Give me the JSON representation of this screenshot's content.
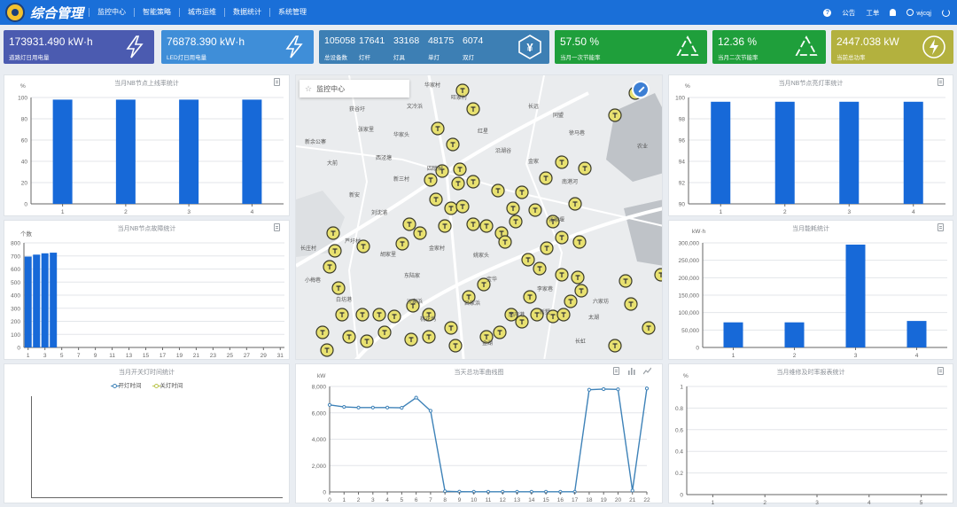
{
  "nav": {
    "title": "综合管理",
    "items": [
      "监控中心",
      "智能策略",
      "城市运维",
      "数据统计",
      "系统管理"
    ],
    "right": {
      "notice": "公告",
      "workorder": "工单",
      "user": "wjcqj"
    }
  },
  "cards": {
    "road_light": {
      "value": "173931.490 kW·h",
      "label": "道路灯日用电量"
    },
    "led_light": {
      "value": "76878.390 kW·h",
      "label": "LED灯日用电量"
    },
    "devices": [
      {
        "value": "105058",
        "label": "总设备数"
      },
      {
        "value": "17641",
        "label": "灯杆"
      },
      {
        "value": "33168",
        "label": "灯具"
      },
      {
        "value": "48175",
        "label": "单灯"
      },
      {
        "value": "6074",
        "label": "双灯"
      }
    ],
    "saving_month1": {
      "value": "57.50 %",
      "label": "当月一次节能率"
    },
    "saving_month2": {
      "value": "12.36 %",
      "label": "当月二次节能率"
    },
    "total_power": {
      "value": "2447.038 kW",
      "label": "当前总功率"
    }
  },
  "map": {
    "search_label": "监控中心",
    "places": [
      "华家村",
      "旺家村",
      "获谷圩",
      "文冷浜",
      "张家里",
      "新余公寨",
      "华家头",
      "红星",
      "长远",
      "同盟",
      "徐马巷",
      "沿湖谷",
      "大前",
      "西泾塘",
      "金家",
      "农业",
      "新三村",
      "四联村",
      "南港河",
      "新安",
      "刘沈浦",
      "张家堰",
      "长庄村",
      "胡家里",
      "芦圩村",
      "金家村",
      "姚家头",
      "东陆家",
      "宝华",
      "李家巷",
      "小梅巷",
      "沙家浜",
      "白坊港",
      "南岸港",
      "新墅",
      "桃花坞",
      "金湖",
      "长虹",
      "六家坊",
      "吕家浜",
      "太湖"
    ]
  },
  "panels": {
    "online_rate": {
      "title": "当月NB节点上线率统计",
      "unit": "%"
    },
    "fault": {
      "title": "当月NB节点故障统计",
      "unit": "个数"
    },
    "switch_time": {
      "title": "当月开关灯时间统计",
      "legend_on": "开灯时间",
      "legend_off": "关灯时间"
    },
    "power_curve": {
      "title": "当天总功率曲线图",
      "unit": "kW"
    },
    "bright_rate": {
      "title": "当月NB节点亮灯率统计",
      "unit": "%"
    },
    "energy": {
      "title": "当月能耗统计",
      "unit": "kW·h"
    },
    "repair_rate": {
      "title": "当月维修及时率报表统计",
      "unit": "%"
    }
  },
  "colors": {
    "bar": "#1769d8",
    "line": "#3e82b8",
    "topbar": "#1a6fd8"
  },
  "chart_data": [
    {
      "type": "bar",
      "title": "当月NB节点上线率统计",
      "categories": [
        "1",
        "2",
        "3",
        "4"
      ],
      "values": [
        98,
        98,
        98,
        98
      ],
      "ylabel": "%",
      "ylim": [
        0,
        100
      ],
      "yticks": [
        0,
        20,
        40,
        60,
        80,
        100
      ]
    },
    {
      "type": "bar",
      "title": "当月NB节点故障统计",
      "categories": [
        "1",
        "2",
        "3",
        "4",
        "5",
        "6",
        "7",
        "8",
        "9",
        "10",
        "11",
        "12",
        "13",
        "14",
        "15",
        "16",
        "17",
        "18",
        "19",
        "20",
        "21",
        "22",
        "23",
        "24",
        "25",
        "26",
        "27",
        "28",
        "29",
        "30",
        "31"
      ],
      "xtick_labels": [
        "1",
        "3",
        "5",
        "7",
        "9",
        "11",
        "13",
        "15",
        "17",
        "19",
        "21",
        "23",
        "25",
        "27",
        "29",
        "31"
      ],
      "values": [
        695,
        710,
        720,
        725
      ],
      "ylabel": "个数",
      "ylim": [
        0,
        800
      ],
      "yticks": [
        0,
        100,
        200,
        300,
        400,
        500,
        600,
        700,
        800
      ]
    },
    {
      "type": "line",
      "title": "当月开关灯时间统计",
      "series": [
        {
          "name": "开灯时间",
          "values": []
        },
        {
          "name": "关灯时间",
          "values": []
        }
      ]
    },
    {
      "type": "line",
      "title": "当天总功率曲线图",
      "x": [
        "0",
        "1",
        "2",
        "3",
        "4",
        "5",
        "6",
        "7",
        "8",
        "9",
        "10",
        "11",
        "12",
        "13",
        "14",
        "15",
        "16",
        "17",
        "18",
        "19",
        "20",
        "21",
        "22"
      ],
      "series": [
        {
          "values": [
            6600,
            6450,
            6400,
            6400,
            6400,
            6380,
            7150,
            6150,
            50,
            20,
            10,
            10,
            10,
            10,
            10,
            10,
            10,
            10,
            7750,
            7800,
            7780,
            100,
            7850
          ]
        }
      ],
      "ylabel": "kW",
      "ylim": [
        0,
        8000
      ],
      "yticks": [
        0,
        2000,
        4000,
        6000,
        8000
      ]
    },
    {
      "type": "bar",
      "title": "当月NB节点亮灯率统计",
      "categories": [
        "1",
        "2",
        "3",
        "4"
      ],
      "values": [
        99.6,
        99.6,
        99.6,
        99.6
      ],
      "ylabel": "%",
      "ylim": [
        90,
        100
      ],
      "yticks": [
        90,
        92,
        94,
        96,
        98,
        100
      ]
    },
    {
      "type": "bar",
      "title": "当月能耗统计",
      "categories": [
        "1",
        "2",
        "3",
        "4"
      ],
      "values": [
        72000,
        72000,
        295000,
        76000
      ],
      "ylabel": "kW·h",
      "ylim": [
        0,
        300000
      ],
      "yticks": [
        0,
        50000,
        100000,
        150000,
        200000,
        250000,
        300000
      ],
      "ytick_labels": [
        "0",
        "50,000",
        "100,000",
        "150,000",
        "200,000",
        "250,000",
        "300,000"
      ]
    },
    {
      "type": "bar",
      "title": "当月维修及时率报表统计",
      "categories": [
        "1",
        "2",
        "3",
        "4",
        "5"
      ],
      "values": [],
      "ylabel": "%",
      "ylim": [
        0,
        1
      ],
      "yticks": [
        0,
        0.2,
        0.4,
        0.6,
        0.8,
        1
      ],
      "ytick_labels": [
        "0",
        "0.2",
        "0.4",
        "0.6",
        "0.8",
        "1"
      ]
    }
  ]
}
